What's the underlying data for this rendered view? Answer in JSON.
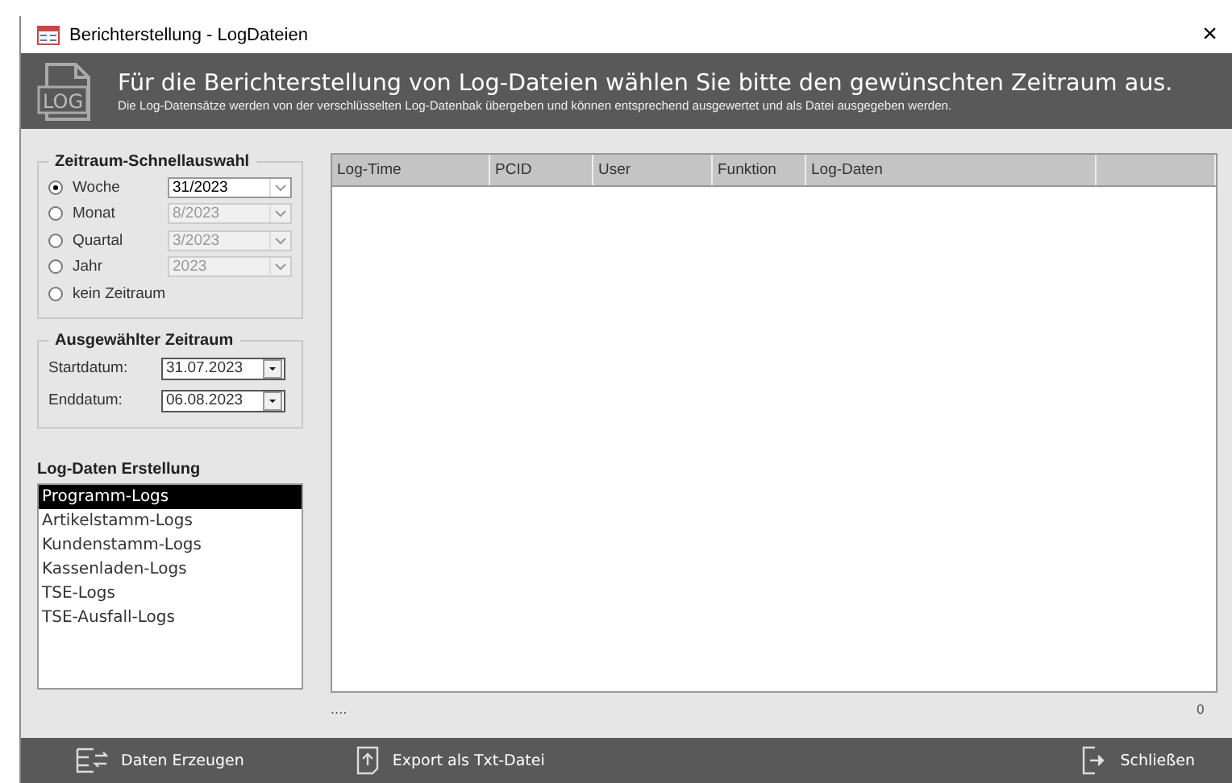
{
  "window": {
    "title": "Berichterstellung - LogDateien",
    "close": "×"
  },
  "header": {
    "icon_text": "LOG",
    "title": "Für die Berichterstellung von Log-Dateien wählen Sie bitte den gewünschten Zeitraum aus.",
    "subtitle": "Die Log-Datensätze werden von der verschlüsselten Log-Datenbak übergeben und können entsprechend ausgewertet und als Datei ausgegeben werden."
  },
  "quick_select": {
    "title": "Zeitraum-Schnellauswahl",
    "options": [
      {
        "label": "Woche",
        "selected": true,
        "value": "31/2023",
        "disabled": false
      },
      {
        "label": "Monat",
        "selected": false,
        "value": "8/2023",
        "disabled": true
      },
      {
        "label": "Quartal",
        "selected": false,
        "value": "3/2023",
        "disabled": true
      },
      {
        "label": "Jahr",
        "selected": false,
        "value": "2023",
        "disabled": true
      },
      {
        "label": "kein Zeitraum",
        "selected": false
      }
    ]
  },
  "selected_range": {
    "title": "Ausgewählter Zeitraum",
    "fields": [
      {
        "label": "Startdatum:",
        "value": "31.07.2023"
      },
      {
        "label": "Enddatum:",
        "value": "06.08.2023"
      }
    ]
  },
  "log_list": {
    "title": "Log-Daten Erstellung",
    "items": [
      {
        "label": "Programm-Logs",
        "selected": true
      },
      {
        "label": "Artikelstamm-Logs",
        "selected": false
      },
      {
        "label": "Kundenstamm-Logs",
        "selected": false
      },
      {
        "label": "Kassenladen-Logs",
        "selected": false
      },
      {
        "label": "TSE-Logs",
        "selected": false
      },
      {
        "label": "TSE-Ausfall-Logs",
        "selected": false
      }
    ]
  },
  "table": {
    "columns": [
      "Log-Time",
      "PCID",
      "User",
      "Funktion",
      "Log-Daten"
    ]
  },
  "status": {
    "left": "....",
    "count": "0"
  },
  "footer": {
    "buttons": [
      {
        "kind": "generate",
        "label": "Daten Erzeugen"
      },
      {
        "kind": "export",
        "label": "Export als Txt-Datei"
      },
      {
        "kind": "close",
        "label": "Schließen"
      }
    ]
  }
}
